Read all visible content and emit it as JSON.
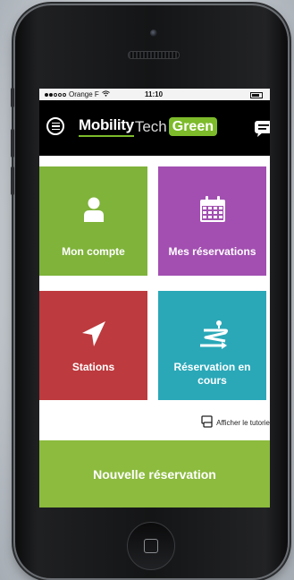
{
  "status_bar": {
    "carrier": "Orange F",
    "time": "11:10"
  },
  "header": {
    "logo_mobility": "Mobility",
    "logo_tech": "Tech",
    "logo_green": "Green",
    "menu_icon": "hamburger-circle-icon",
    "help_icon": "chat-bubble-icon"
  },
  "tiles": [
    {
      "label": "Mon compte",
      "icon": "user-icon",
      "color": "#7fb33a"
    },
    {
      "label": "Mes réservations",
      "icon": "calendar-icon",
      "color": "#a24fb1"
    },
    {
      "label": "Stations",
      "icon": "navigation-arrow-icon",
      "color": "#bd3a3e"
    },
    {
      "label": "Réservation en cours",
      "icon": "route-icon",
      "color": "#2aa8b8"
    }
  ],
  "tutorial": {
    "label": "Afficher le tutorie",
    "icon": "tutorial-icon"
  },
  "new_reservation": {
    "label": "Nouvelle réservation",
    "color": "#8cbb3e"
  }
}
